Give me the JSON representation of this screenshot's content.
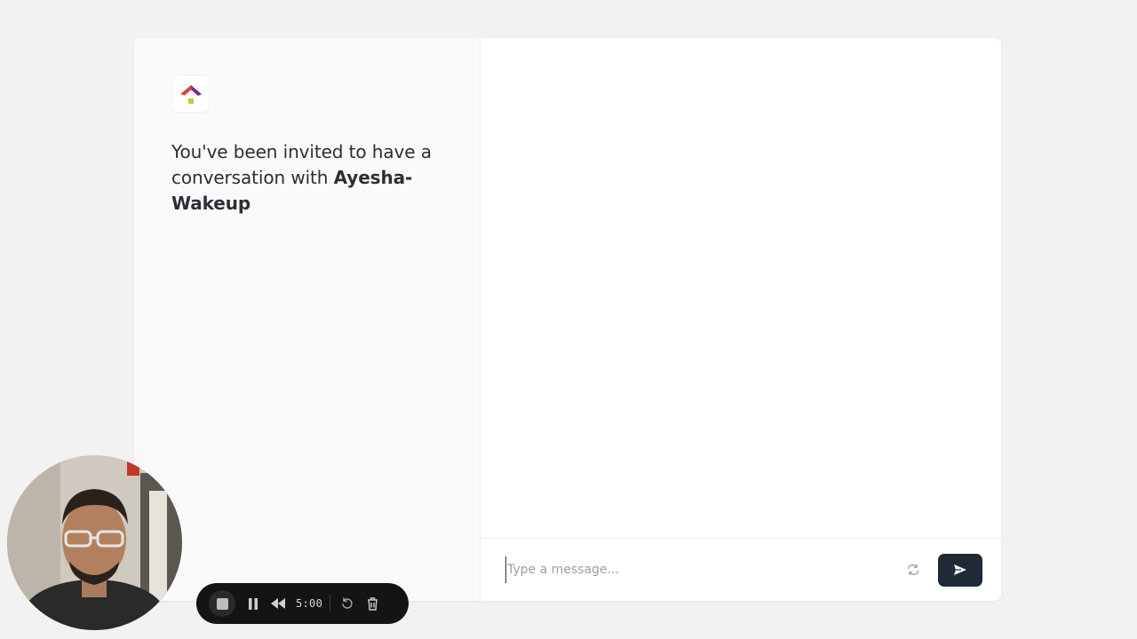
{
  "invite": {
    "prefix": "You've been invited to have a conversation with ",
    "agent_name": "Ayesha-Wakeup"
  },
  "composer": {
    "placeholder": "Type a message..."
  },
  "recorder": {
    "time": "5:00"
  },
  "colors": {
    "background": "#f2f2f2",
    "left_panel": "#fafafa",
    "send_button": "#1f2937",
    "logo_purple": "#7b2d8e",
    "logo_red": "#e0413a",
    "logo_green": "#a8d83a"
  },
  "icons": {
    "logo": "house-logo-icon",
    "refresh": "refresh-icon",
    "send": "send-icon",
    "stop": "stop-icon",
    "pause": "pause-icon",
    "rewind": "rewind-icon",
    "restart": "restart-icon",
    "delete": "trash-icon"
  }
}
